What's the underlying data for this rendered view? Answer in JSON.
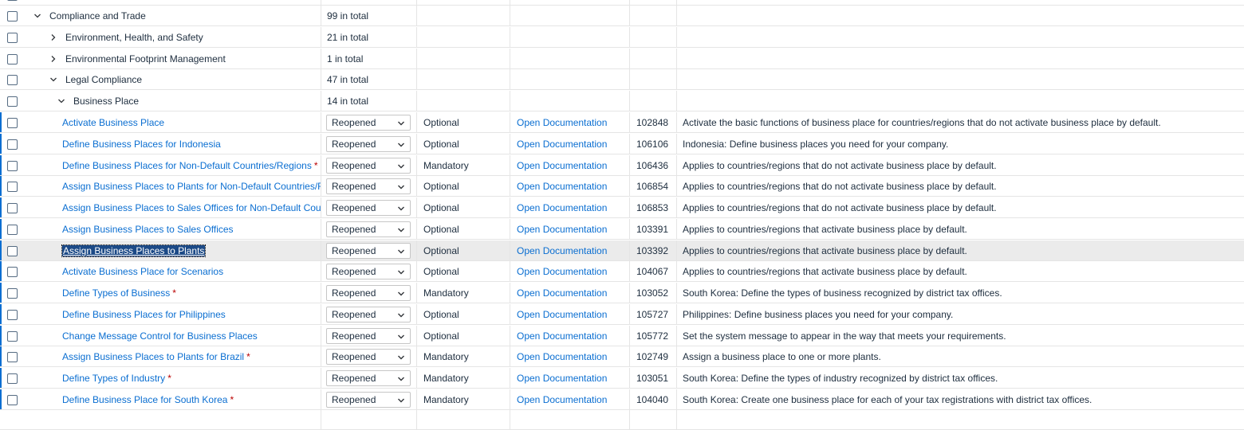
{
  "groups": [
    {
      "label": "Compliance and Trade",
      "total": "99 in total",
      "state": "expanded"
    },
    {
      "label": "Environment, Health, and Safety",
      "total": "21 in total",
      "state": "collapsed"
    },
    {
      "label": "Environmental Footprint Management",
      "total": "1 in total",
      "state": "collapsed"
    },
    {
      "label": "Legal Compliance",
      "total": "47 in total",
      "state": "expanded"
    },
    {
      "label": "Business Place",
      "total": "14 in total",
      "state": "expanded"
    }
  ],
  "activities": [
    {
      "name": "Activate Business Place",
      "required": false,
      "status": "Reopened",
      "type": "Optional",
      "doc": "Open Documentation",
      "id": "102848",
      "desc": "Activate the basic functions of business place for countries/regions that do not activate business place by default."
    },
    {
      "name": "Define Business Places for Indonesia",
      "required": false,
      "status": "Reopened",
      "type": "Optional",
      "doc": "Open Documentation",
      "id": "106106",
      "desc": "Indonesia: Define business places you need for your company."
    },
    {
      "name": "Define Business Places for Non-Default Countries/Regions",
      "required": true,
      "status": "Reopened",
      "type": "Mandatory",
      "doc": "Open Documentation",
      "id": "106436",
      "desc": "Applies to countries/regions that do not activate business place by default."
    },
    {
      "name": "Assign Business Places to Plants for Non-Default Countries/Reg",
      "required": false,
      "status": "Reopened",
      "type": "Optional",
      "doc": "Open Documentation",
      "id": "106854",
      "desc": "Applies to countries/regions that do not activate business place by default."
    },
    {
      "name": "Assign Business Places to Sales Offices for Non-Default Countr",
      "required": false,
      "status": "Reopened",
      "type": "Optional",
      "doc": "Open Documentation",
      "id": "106853",
      "desc": "Applies to countries/regions that do not activate business place by default."
    },
    {
      "name": "Assign Business Places to Sales Offices",
      "required": false,
      "status": "Reopened",
      "type": "Optional",
      "doc": "Open Documentation",
      "id": "103391",
      "desc": "Applies to countries/regions that activate business place by default."
    },
    {
      "name": "Assign Business Places to Plants",
      "required": false,
      "status": "Reopened",
      "type": "Optional",
      "doc": "Open Documentation",
      "id": "103392",
      "desc": "Applies to countries/regions that activate business place by default.",
      "selected": true
    },
    {
      "name": "Activate Business Place for Scenarios",
      "required": false,
      "status": "Reopened",
      "type": "Optional",
      "doc": "Open Documentation",
      "id": "104067",
      "desc": "Applies to countries/regions that activate business place by default."
    },
    {
      "name": "Define Types of Business",
      "required": true,
      "status": "Reopened",
      "type": "Mandatory",
      "doc": "Open Documentation",
      "id": "103052",
      "desc": "South Korea: Define the types of business recognized by district tax offices."
    },
    {
      "name": "Define Business Places for Philippines",
      "required": false,
      "status": "Reopened",
      "type": "Optional",
      "doc": "Open Documentation",
      "id": "105727",
      "desc": "Philippines: Define business places you need for your company."
    },
    {
      "name": "Change Message Control for Business Places",
      "required": false,
      "status": "Reopened",
      "type": "Optional",
      "doc": "Open Documentation",
      "id": "105772",
      "desc": "Set the system message to appear in the way that meets your requirements."
    },
    {
      "name": "Assign Business Places to Plants for Brazil",
      "required": true,
      "status": "Reopened",
      "type": "Mandatory",
      "doc": "Open Documentation",
      "id": "102749",
      "desc": "Assign a business place to one or more plants."
    },
    {
      "name": "Define Types of Industry",
      "required": true,
      "status": "Reopened",
      "type": "Mandatory",
      "doc": "Open Documentation",
      "id": "103051",
      "desc": "South Korea: Define the types of industry recognized by district tax offices."
    },
    {
      "name": "Define Business Place for South Korea",
      "required": true,
      "status": "Reopened",
      "type": "Mandatory",
      "doc": "Open Documentation",
      "id": "104040",
      "desc": "South Korea: Create one business place for each of your tax registrations with district tax offices."
    }
  ],
  "required_marker": "*",
  "colors": {
    "link": "#0a6ed1",
    "required": "#bb0000",
    "selected_row": "#ebebeb",
    "focus": "#1c4a87"
  }
}
